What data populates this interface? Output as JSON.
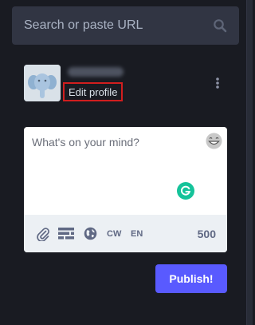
{
  "search": {
    "placeholder": "Search or paste URL",
    "icon": "search-icon"
  },
  "profile": {
    "edit_label": "Edit profile",
    "avatar_icon": "elephant-avatar",
    "menu_icon": "more-vertical-icon"
  },
  "compose": {
    "placeholder": "What's on your mind?",
    "emoji_icon": "grinning-emoji-icon",
    "grammarly_icon": "grammarly-icon",
    "toolbar": {
      "attach_icon": "paperclip-icon",
      "poll_icon": "poll-icon",
      "visibility_icon": "globe-icon",
      "cw_label": "CW",
      "language_label": "EN",
      "char_count": "500"
    }
  },
  "publish_label": "Publish!",
  "colors": {
    "background": "#191b22",
    "search_background": "#313543",
    "accent": "#595aff",
    "highlight_border": "#d11e1e",
    "grammarly": "#15c39a"
  }
}
